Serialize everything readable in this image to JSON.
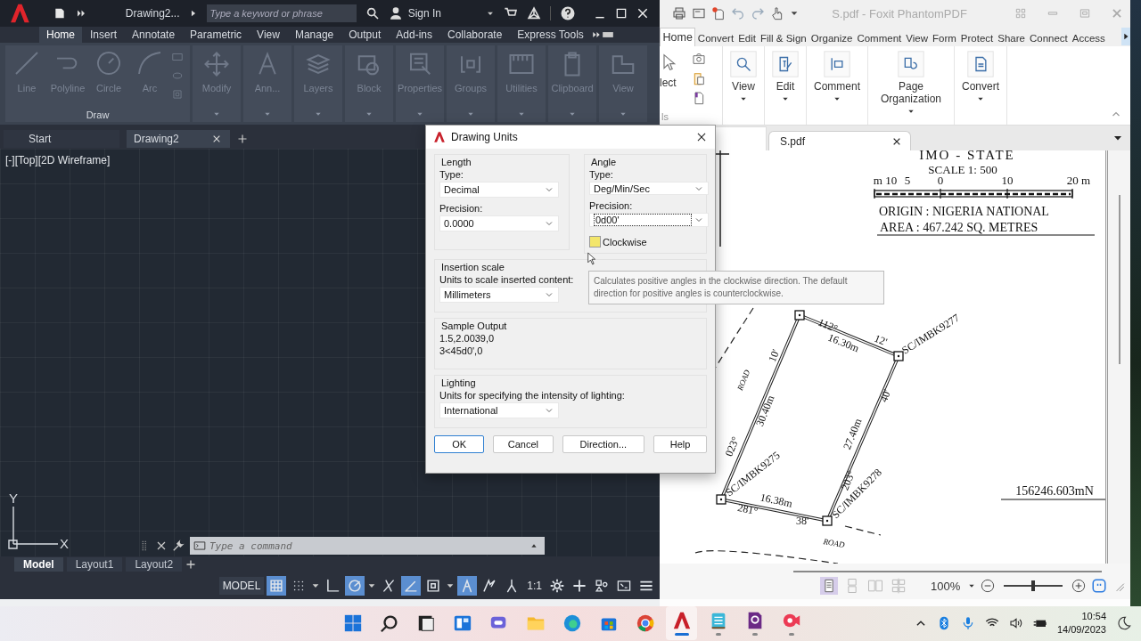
{
  "autocad": {
    "title_bar": {
      "document": "Drawing2...",
      "search": {
        "placeholder": "Type a keyword or phrase"
      },
      "sign_in": "Sign In"
    },
    "ribbon_tabs": [
      {
        "label": "Home",
        "selected": true
      },
      {
        "label": "Insert",
        "selected": false
      },
      {
        "label": "Annotate",
        "selected": false
      },
      {
        "label": "Parametric",
        "selected": false
      },
      {
        "label": "View",
        "selected": false
      },
      {
        "label": "Manage",
        "selected": false
      },
      {
        "label": "Output",
        "selected": false
      },
      {
        "label": "Add-ins",
        "selected": false
      },
      {
        "label": "Collaborate",
        "selected": false
      },
      {
        "label": "Express Tools",
        "selected": false
      }
    ],
    "draw_tools": [
      {
        "kind": "line",
        "label": "Line"
      },
      {
        "kind": "polyline",
        "label": "Polyline"
      },
      {
        "kind": "circle",
        "label": "Circle"
      },
      {
        "kind": "arc",
        "label": "Arc"
      }
    ],
    "draw_panel": "Draw",
    "panels": [
      {
        "kind": "move",
        "label": "Modify"
      },
      {
        "kind": "annotate",
        "label": "Ann..."
      },
      {
        "kind": "layers",
        "label": "Layers"
      },
      {
        "kind": "block",
        "label": "Block"
      },
      {
        "kind": "properties",
        "label": "Properties"
      },
      {
        "kind": "groups",
        "label": "Groups"
      },
      {
        "kind": "utilities",
        "label": "Utilities"
      },
      {
        "kind": "clipboard",
        "label": "Clipboard"
      },
      {
        "kind": "view",
        "label": "View"
      }
    ],
    "file_tabs": [
      {
        "label": "Start",
        "selected": false
      },
      {
        "label": "Drawing2",
        "selected": true
      }
    ],
    "viewport_label": "[-][Top][2D Wireframe]",
    "ucs": {
      "x": "X",
      "y": "Y"
    },
    "command": {
      "placeholder": "Type a command"
    },
    "layout_tabs": [
      {
        "label": "Model",
        "selected": true
      },
      {
        "label": "Layout1",
        "selected": false
      },
      {
        "label": "Layout2",
        "selected": false
      }
    ],
    "status_bar": {
      "model": "MODEL",
      "scale": "1:1",
      "toggles": [
        {
          "kind": "grid",
          "on": true
        },
        {
          "kind": "snap",
          "on": false
        },
        {
          "kind": "ortho",
          "on": false
        },
        {
          "kind": "polar",
          "on": true
        },
        {
          "kind": "isometric",
          "on": false
        },
        {
          "kind": "angle",
          "on": true
        },
        {
          "kind": "osnap",
          "on": false
        },
        {
          "kind": "visibility",
          "on": true
        },
        {
          "kind": "autoscale",
          "on": false
        },
        {
          "kind": "annoscale",
          "on": false
        }
      ]
    }
  },
  "pdf": {
    "title": "S.pdf - Foxit PhantomPDF",
    "tabs": [
      {
        "label": "Home",
        "selected": true
      },
      {
        "label": "Convert",
        "selected": false
      },
      {
        "label": "Edit",
        "selected": false
      },
      {
        "label": "Fill & Sign",
        "selected": false
      },
      {
        "label": "Organize",
        "selected": false
      },
      {
        "label": "Comment",
        "selected": false
      },
      {
        "label": "View",
        "selected": false
      },
      {
        "label": "Form",
        "selected": false
      },
      {
        "label": "Protect",
        "selected": false
      },
      {
        "label": "Share",
        "selected": false
      },
      {
        "label": "Connect",
        "selected": false
      },
      {
        "label": "Access",
        "selected": false
      }
    ],
    "ribbon": {
      "cut_button": "lect",
      "cut_group": "ls",
      "buttons": [
        {
          "kind": "zoom",
          "label": "View"
        },
        {
          "kind": "edit",
          "label": "Edit"
        },
        {
          "kind": "comment",
          "label": "Comment"
        },
        {
          "kind": "pages",
          "label": "Page Organization"
        },
        {
          "kind": "convert",
          "label": "Convert"
        }
      ]
    },
    "doc_tab": "S.pdf",
    "map": {
      "title": "IMO - STATE",
      "scale": "SCALE 1: 500",
      "scale_ticks": [
        "m 10",
        "5",
        "0",
        "10",
        "20 m"
      ],
      "origin": "ORIGIN  :  NIGERIA  NATIONAL",
      "area": "AREA     : 467.242 SQ. METRES",
      "labels": [
        {
          "text": "112°",
          "kind": "bearing"
        },
        {
          "text": "16.30m",
          "kind": "distance"
        },
        {
          "text": "12'",
          "kind": "bearing"
        },
        {
          "text": "SC/IMBK9277",
          "kind": "beacon"
        },
        {
          "text": "10'",
          "kind": "bearing"
        },
        {
          "text": "ROAD",
          "kind": "road"
        },
        {
          "text": "30.40m",
          "kind": "distance"
        },
        {
          "text": "40'",
          "kind": "bearing"
        },
        {
          "text": "27.40m",
          "kind": "distance"
        },
        {
          "text": "023°",
          "kind": "bearing"
        },
        {
          "text": "SC/IMBK9275",
          "kind": "beacon"
        },
        {
          "text": "203°",
          "kind": "bearing"
        },
        {
          "text": "SC/IMBK9278",
          "kind": "beacon"
        },
        {
          "text": "16.38m",
          "kind": "distance"
        },
        {
          "text": "281°",
          "kind": "bearing"
        },
        {
          "text": "38'",
          "kind": "bearing"
        },
        {
          "text": "ROAD",
          "kind": "road"
        },
        {
          "text": "156246.603mN",
          "kind": "coordinate"
        }
      ]
    },
    "zoom": "100%",
    "zoom_slider": {
      "level": 0.5
    }
  },
  "dialog": {
    "title": "Drawing Units",
    "length": {
      "heading": "Length",
      "type_label": "Type:",
      "type": "Decimal",
      "precision_label": "Precision:",
      "precision": "0.0000"
    },
    "angle": {
      "heading": "Angle",
      "type_label": "Type:",
      "type": "Deg/Min/Sec",
      "precision_label": "Precision:",
      "precision": "0d00'",
      "clockwise": {
        "label": "Clockwise",
        "checked": false
      }
    },
    "insertion": {
      "heading": "Insertion scale",
      "label": "Units to scale inserted content:",
      "value": "Millimeters"
    },
    "sample": {
      "heading": "Sample Output",
      "lines": [
        "1.5,2.0039,0",
        "3<45d0',0"
      ]
    },
    "lighting": {
      "heading": "Lighting",
      "label": "Units for specifying the intensity of lighting:",
      "value": "International"
    },
    "buttons": [
      {
        "label": "OK",
        "default": true
      },
      {
        "label": "Cancel",
        "default": false
      },
      {
        "label": "Direction...",
        "default": false
      },
      {
        "label": "Help",
        "default": false
      }
    ]
  },
  "tooltip": "Calculates positive angles in the clockwise direction. The default direction for positive angles is counterclockwise.",
  "taskbar": {
    "apps": [
      {
        "kind": "start",
        "active": false,
        "running": false
      },
      {
        "kind": "search",
        "active": false,
        "running": false
      },
      {
        "kind": "taskview",
        "active": false,
        "running": false
      },
      {
        "kind": "widgets",
        "active": false,
        "running": false
      },
      {
        "kind": "chat",
        "active": false,
        "running": false
      },
      {
        "kind": "explorer",
        "active": false,
        "running": false
      },
      {
        "kind": "edge",
        "active": false,
        "running": false
      },
      {
        "kind": "store",
        "active": false,
        "running": false
      },
      {
        "kind": "chrome",
        "active": false,
        "running": false
      },
      {
        "kind": "autocad",
        "active": true,
        "running": true
      },
      {
        "kind": "notepad",
        "active": false,
        "running": true
      },
      {
        "kind": "foxit",
        "active": false,
        "running": true
      },
      {
        "kind": "recorder",
        "active": false,
        "running": true
      }
    ],
    "time": "10:54",
    "date": "14/09/2023"
  }
}
